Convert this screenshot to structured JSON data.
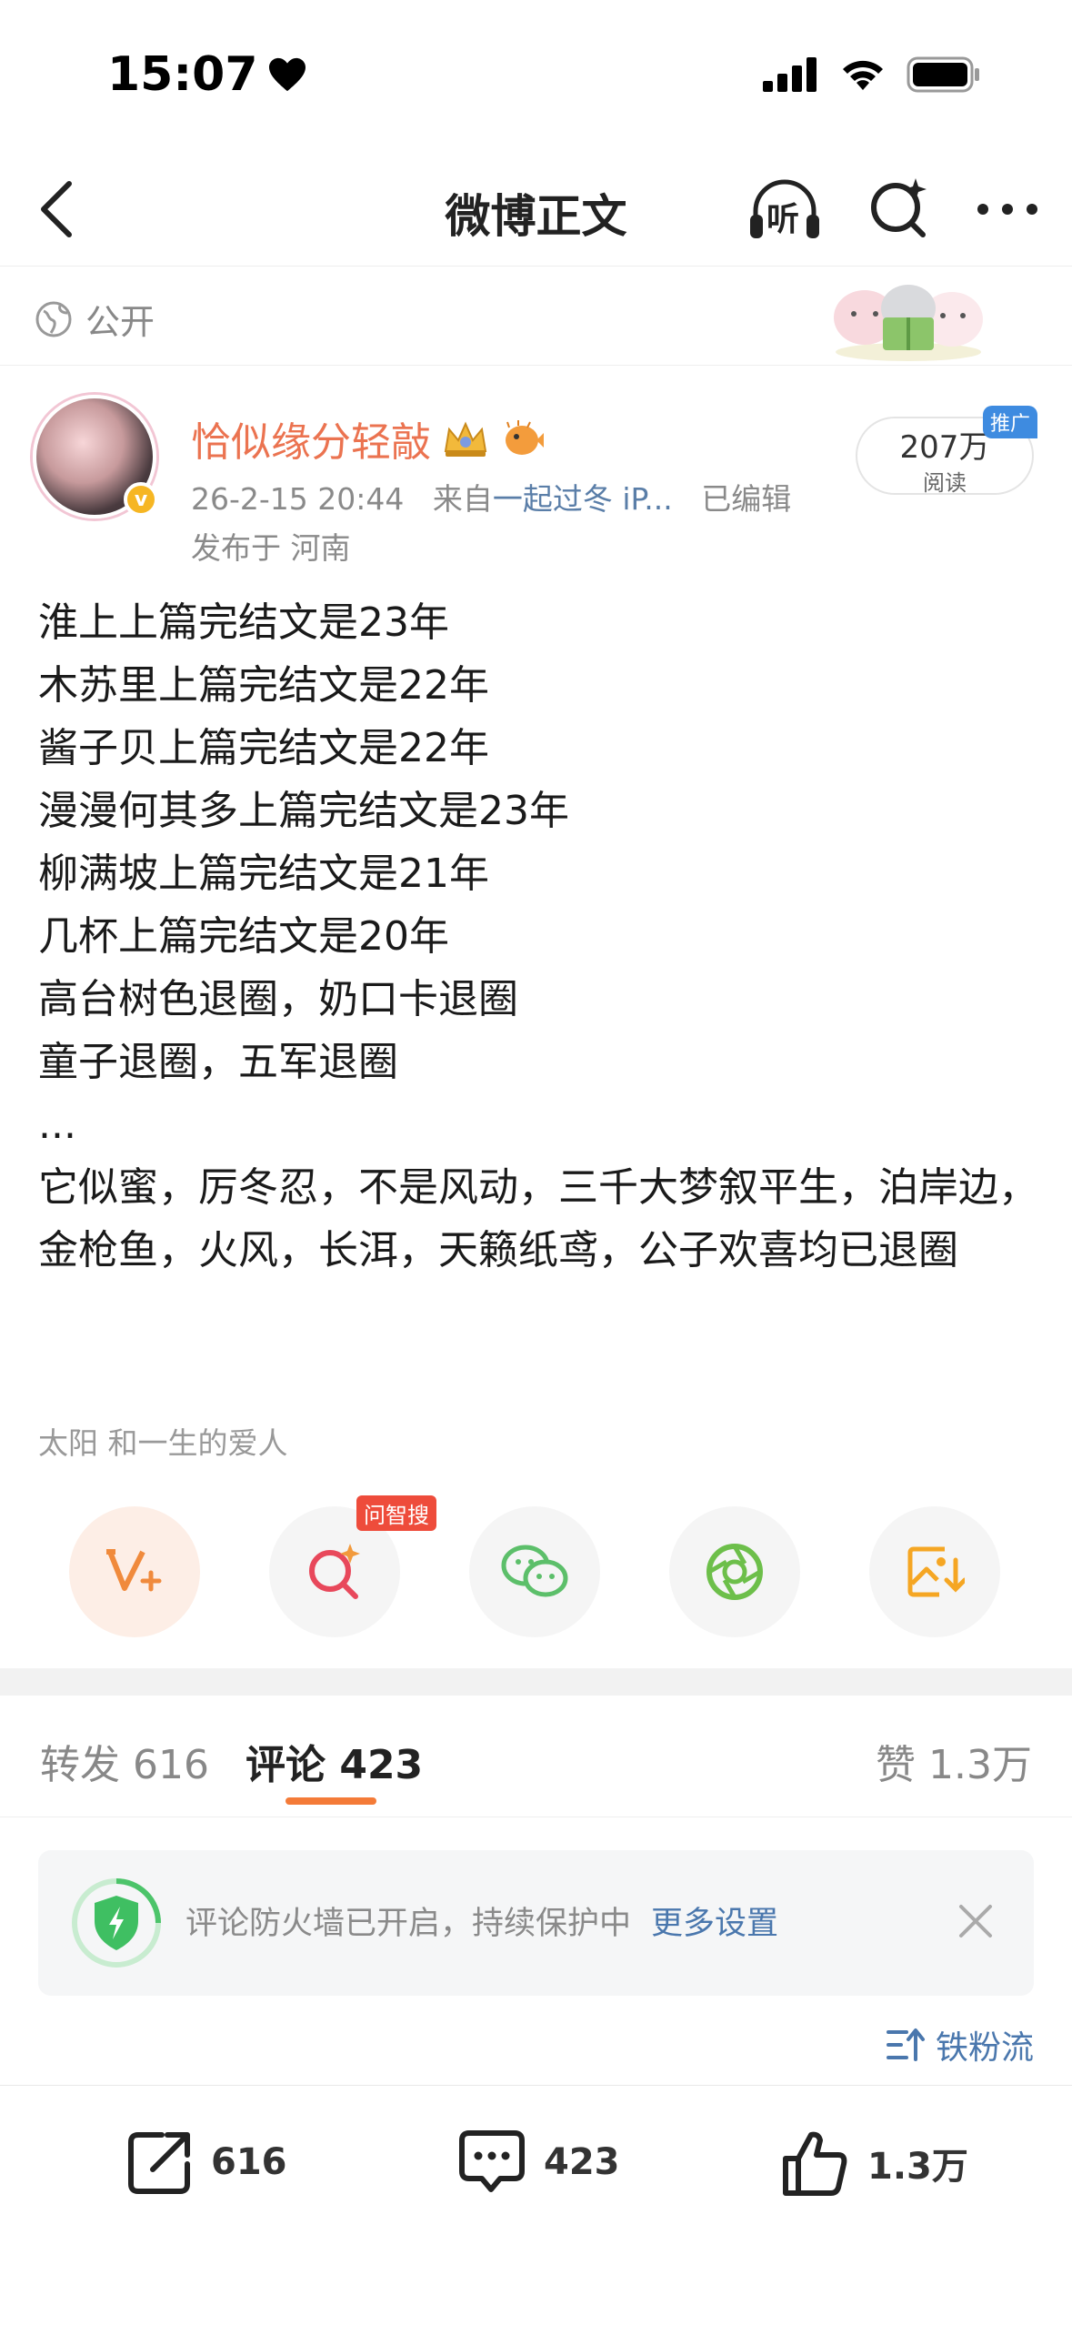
{
  "status_bar": {
    "time": "15:07"
  },
  "nav": {
    "title": "微博正文",
    "listen_label": "听"
  },
  "visibility": {
    "label": "公开"
  },
  "author": {
    "name": "恰似缘分轻敲",
    "date": "26-2-15 20:44",
    "source_prefix": "来自",
    "source": "一起过冬 iP...",
    "edited": "已编辑",
    "location": "发布于 河南",
    "avatar_badge": "v"
  },
  "reads": {
    "count": "207万",
    "label": "阅读",
    "promo": "推广"
  },
  "post": {
    "lines": [
      "淮上上篇完结文是23年",
      "木苏里上篇完结文是22年",
      "酱子贝上篇完结文是22年",
      "漫漫何其多上篇完结文是23年",
      "柳满坡上篇完结文是21年",
      "几杯上篇完结文是20年",
      "高台树色退圈，奶口卡退圈",
      "童子退圈，五军退圈",
      "...",
      "它似蜜，厉冬忍，不是风动，三千大梦叙平生，泊岸边，金枪鱼，火风，长洱，天籁纸鸢，公子欢喜均已退圈"
    ]
  },
  "topic": {
    "text": "太阳  和一生的爱人"
  },
  "share": {
    "ai_search_badge": "问智搜"
  },
  "tabs": {
    "repost_label": "转发",
    "repost_count": "616",
    "comment_label": "评论",
    "comment_count": "423",
    "like_label": "赞",
    "like_count": "1.3万"
  },
  "firewall": {
    "text": "评论防火墙已开启，持续保护中",
    "link": "更多设置"
  },
  "sort": {
    "label": "铁粉流"
  },
  "actions": {
    "repost": "616",
    "comment": "423",
    "like": "1.3万"
  },
  "colors": {
    "accent_orange": "#eb7350",
    "link_blue": "#4a77ad",
    "tab_underline": "#f47b38"
  }
}
